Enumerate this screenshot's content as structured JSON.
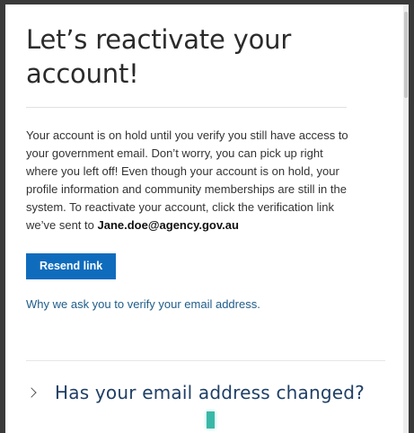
{
  "dialog": {
    "title": "Let’s reactivate your account!",
    "body_text": "Your account is on hold until you verify you still have access to your government email. Don’t worry, you can pick up right where you left off! Even though your account is on hold, your profile information and community memberships are still in the system. To reactivate your account, click the verification link we’ve sent to ",
    "email": "Jane.doe@agency.gov.au",
    "resend_label": "Resend link",
    "why_link": "Why we ask you to verify your email address.",
    "accordion_title": "Has your email address changed?"
  },
  "colors": {
    "button_bg": "#0f6cbd",
    "link": "#205d8a",
    "accordion_title": "#1f3f66"
  }
}
